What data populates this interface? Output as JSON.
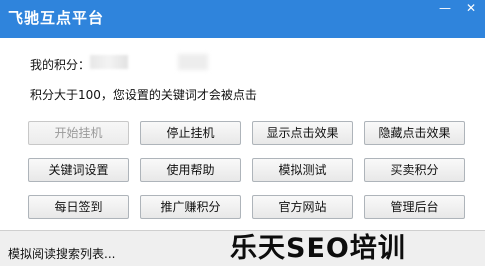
{
  "window": {
    "title": "飞驰互点平台",
    "minimize_symbol": "—",
    "close_symbol": "✕"
  },
  "info": {
    "points_label": "我的积分：",
    "points_value": "",
    "threshold_text": "积分大于100，您设置的关键词才会被点击"
  },
  "buttons": [
    {
      "label": "开始挂机",
      "disabled": true
    },
    {
      "label": "停止挂机",
      "disabled": false
    },
    {
      "label": "显示点击效果",
      "disabled": false
    },
    {
      "label": "隐藏点击效果",
      "disabled": false
    },
    {
      "label": "关键词设置",
      "disabled": false
    },
    {
      "label": "使用帮助",
      "disabled": false
    },
    {
      "label": "模拟测试",
      "disabled": false
    },
    {
      "label": "买卖积分",
      "disabled": false
    },
    {
      "label": "每日签到",
      "disabled": false
    },
    {
      "label": "推广赚积分",
      "disabled": false
    },
    {
      "label": "官方网站",
      "disabled": false
    },
    {
      "label": "管理后台",
      "disabled": false
    }
  ],
  "status": {
    "text": "模拟阅读搜索列表..."
  },
  "watermark": {
    "text": "乐天SEO培训"
  }
}
